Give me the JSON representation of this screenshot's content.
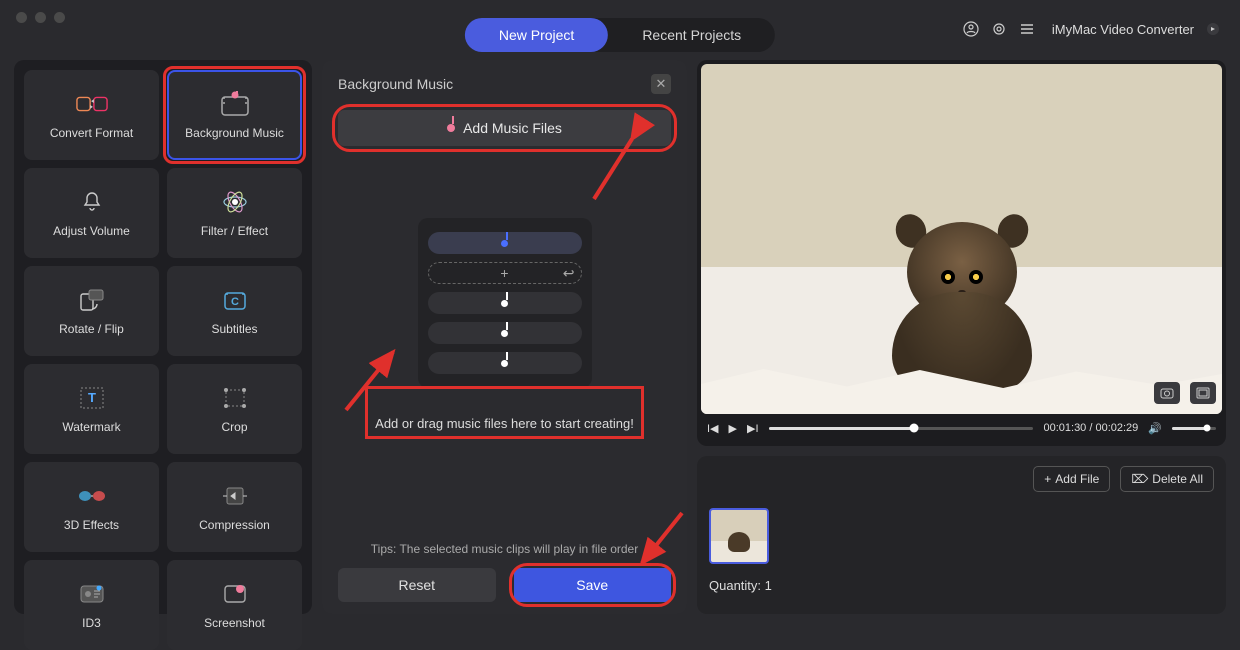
{
  "app": {
    "name": "iMyMac Video Converter"
  },
  "tabs": {
    "new": "New Project",
    "recent": "Recent Projects"
  },
  "tools": {
    "convert": "Convert Format",
    "bgmusic": "Background Music",
    "volume": "Adjust Volume",
    "filter": "Filter / Effect",
    "rotate": "Rotate / Flip",
    "subtitles": "Subtitles",
    "watermark": "Watermark",
    "crop": "Crop",
    "effects3d": "3D Effects",
    "compression": "Compression",
    "id3": "ID3",
    "screenshot": "Screenshot"
  },
  "panel": {
    "title": "Background Music",
    "add_btn": "Add Music Files",
    "drag_tip": "Add or drag music files here to start creating!",
    "tips": "Tips: The selected music clips will play in file order",
    "reset": "Reset",
    "save": "Save"
  },
  "player": {
    "time": "00:01:30 / 00:02:29"
  },
  "queue": {
    "add_file": "Add File",
    "delete_all": "Delete All",
    "quantity_label": "Quantity: 1"
  },
  "colors": {
    "accent": "#4a5cde",
    "red": "#e0302c"
  }
}
